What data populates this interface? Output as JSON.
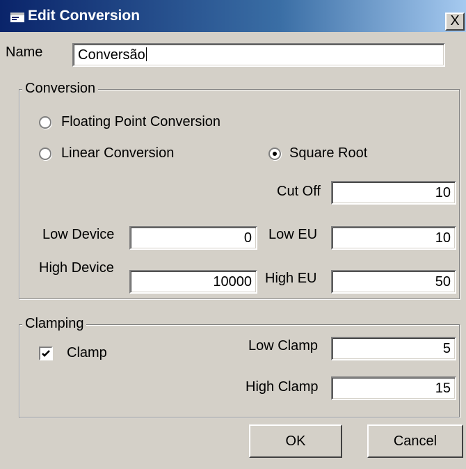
{
  "window": {
    "title": "Edit Conversion",
    "close_glyph": "X",
    "icon": "window-icon"
  },
  "name_field": {
    "label": "Name",
    "value": "Conversão"
  },
  "conversion_group": {
    "legend": "Conversion",
    "options": {
      "floating_point": {
        "label": "Floating Point Conversion",
        "selected": false
      },
      "linear": {
        "label": "Linear Conversion",
        "selected": false
      },
      "square_root": {
        "label": "Square Root",
        "selected": true
      }
    },
    "cut_off": {
      "label": "Cut Off",
      "value": "10"
    },
    "low_device": {
      "label": "Low Device",
      "value": "0"
    },
    "high_device": {
      "label": "High Device",
      "value": "10000"
    },
    "low_eu": {
      "label": "Low EU",
      "value": "10"
    },
    "high_eu": {
      "label": "High EU",
      "value": "50"
    }
  },
  "clamping_group": {
    "legend": "Clamping",
    "clamp": {
      "label": "Clamp",
      "checked": true
    },
    "low_clamp": {
      "label": "Low Clamp",
      "value": "5"
    },
    "high_clamp": {
      "label": "High Clamp",
      "value": "15"
    }
  },
  "buttons": {
    "ok": "OK",
    "cancel": "Cancel"
  },
  "colors": {
    "face": "#d4d0c8",
    "title_start": "#0a246a",
    "title_end": "#a6caf0"
  }
}
